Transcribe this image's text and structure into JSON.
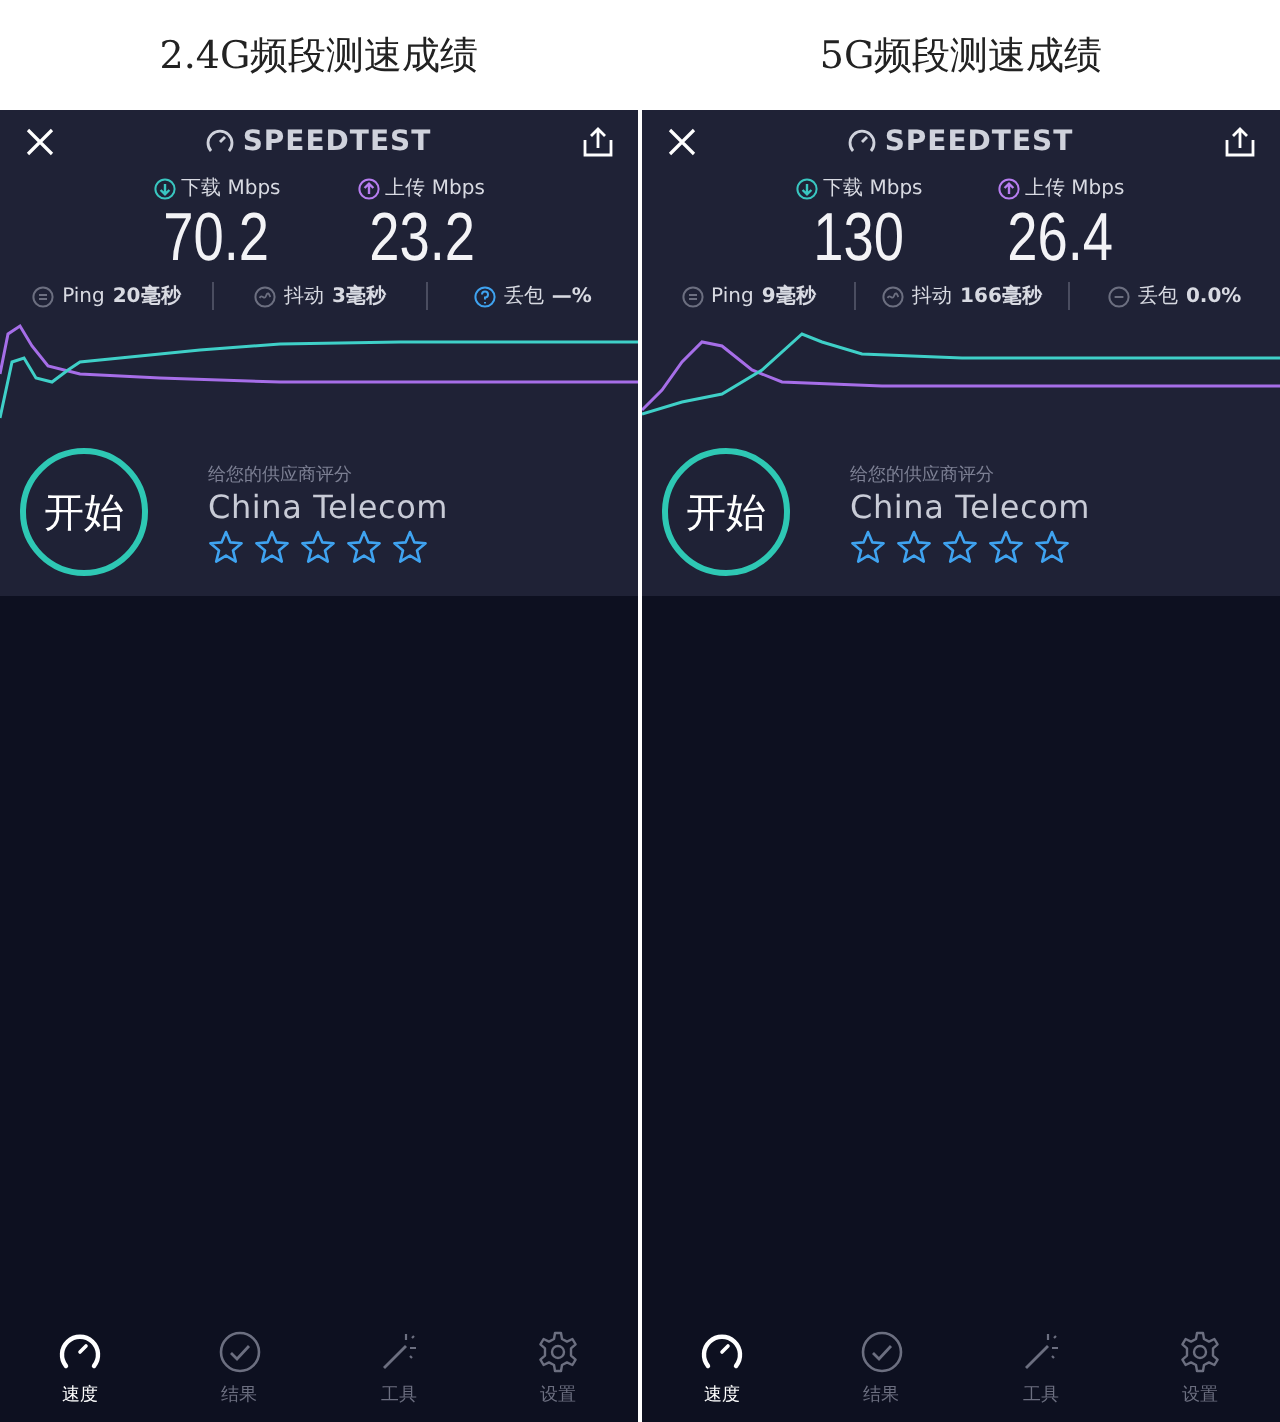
{
  "panels": [
    {
      "heading": "2.4G频段测速成绩",
      "logo": "SPEEDTEST",
      "download": {
        "label": "下载 Mbps",
        "value": "70.2"
      },
      "upload": {
        "label": "上传 Mbps",
        "value": "23.2"
      },
      "stats": [
        {
          "kind": "ping",
          "label": "Ping",
          "value": "20毫秒",
          "unknown": false
        },
        {
          "kind": "jitter",
          "label": "抖动",
          "value": "3毫秒",
          "unknown": false
        },
        {
          "kind": "loss",
          "label": "丢包",
          "value": "—%",
          "unknown": true
        }
      ],
      "start_button": "开始",
      "rating_prompt": "给您的供应商评分",
      "provider": "China Telecom",
      "stars": 0,
      "tabs": [
        {
          "kind": "speed",
          "label": "速度",
          "selected": true
        },
        {
          "kind": "results",
          "label": "结果",
          "selected": false
        },
        {
          "kind": "tools",
          "label": "工具",
          "selected": false
        },
        {
          "kind": "settings",
          "label": "设置",
          "selected": false
        }
      ]
    },
    {
      "heading": "5G频段测速成绩",
      "logo": "SPEEDTEST",
      "download": {
        "label": "下载 Mbps",
        "value": "130"
      },
      "upload": {
        "label": "上传 Mbps",
        "value": "26.4"
      },
      "stats": [
        {
          "kind": "ping",
          "label": "Ping",
          "value": "9毫秒",
          "unknown": false
        },
        {
          "kind": "jitter",
          "label": "抖动",
          "value": "166毫秒",
          "unknown": false
        },
        {
          "kind": "loss",
          "label": "丢包",
          "value": "0.0%",
          "unknown": false
        }
      ],
      "start_button": "开始",
      "rating_prompt": "给您的供应商评分",
      "provider": "China Telecom",
      "stars": 0,
      "tabs": [
        {
          "kind": "speed",
          "label": "速度",
          "selected": true
        },
        {
          "kind": "results",
          "label": "结果",
          "selected": false
        },
        {
          "kind": "tools",
          "label": "工具",
          "selected": false
        },
        {
          "kind": "settings",
          "label": "设置",
          "selected": false
        }
      ]
    }
  ]
}
